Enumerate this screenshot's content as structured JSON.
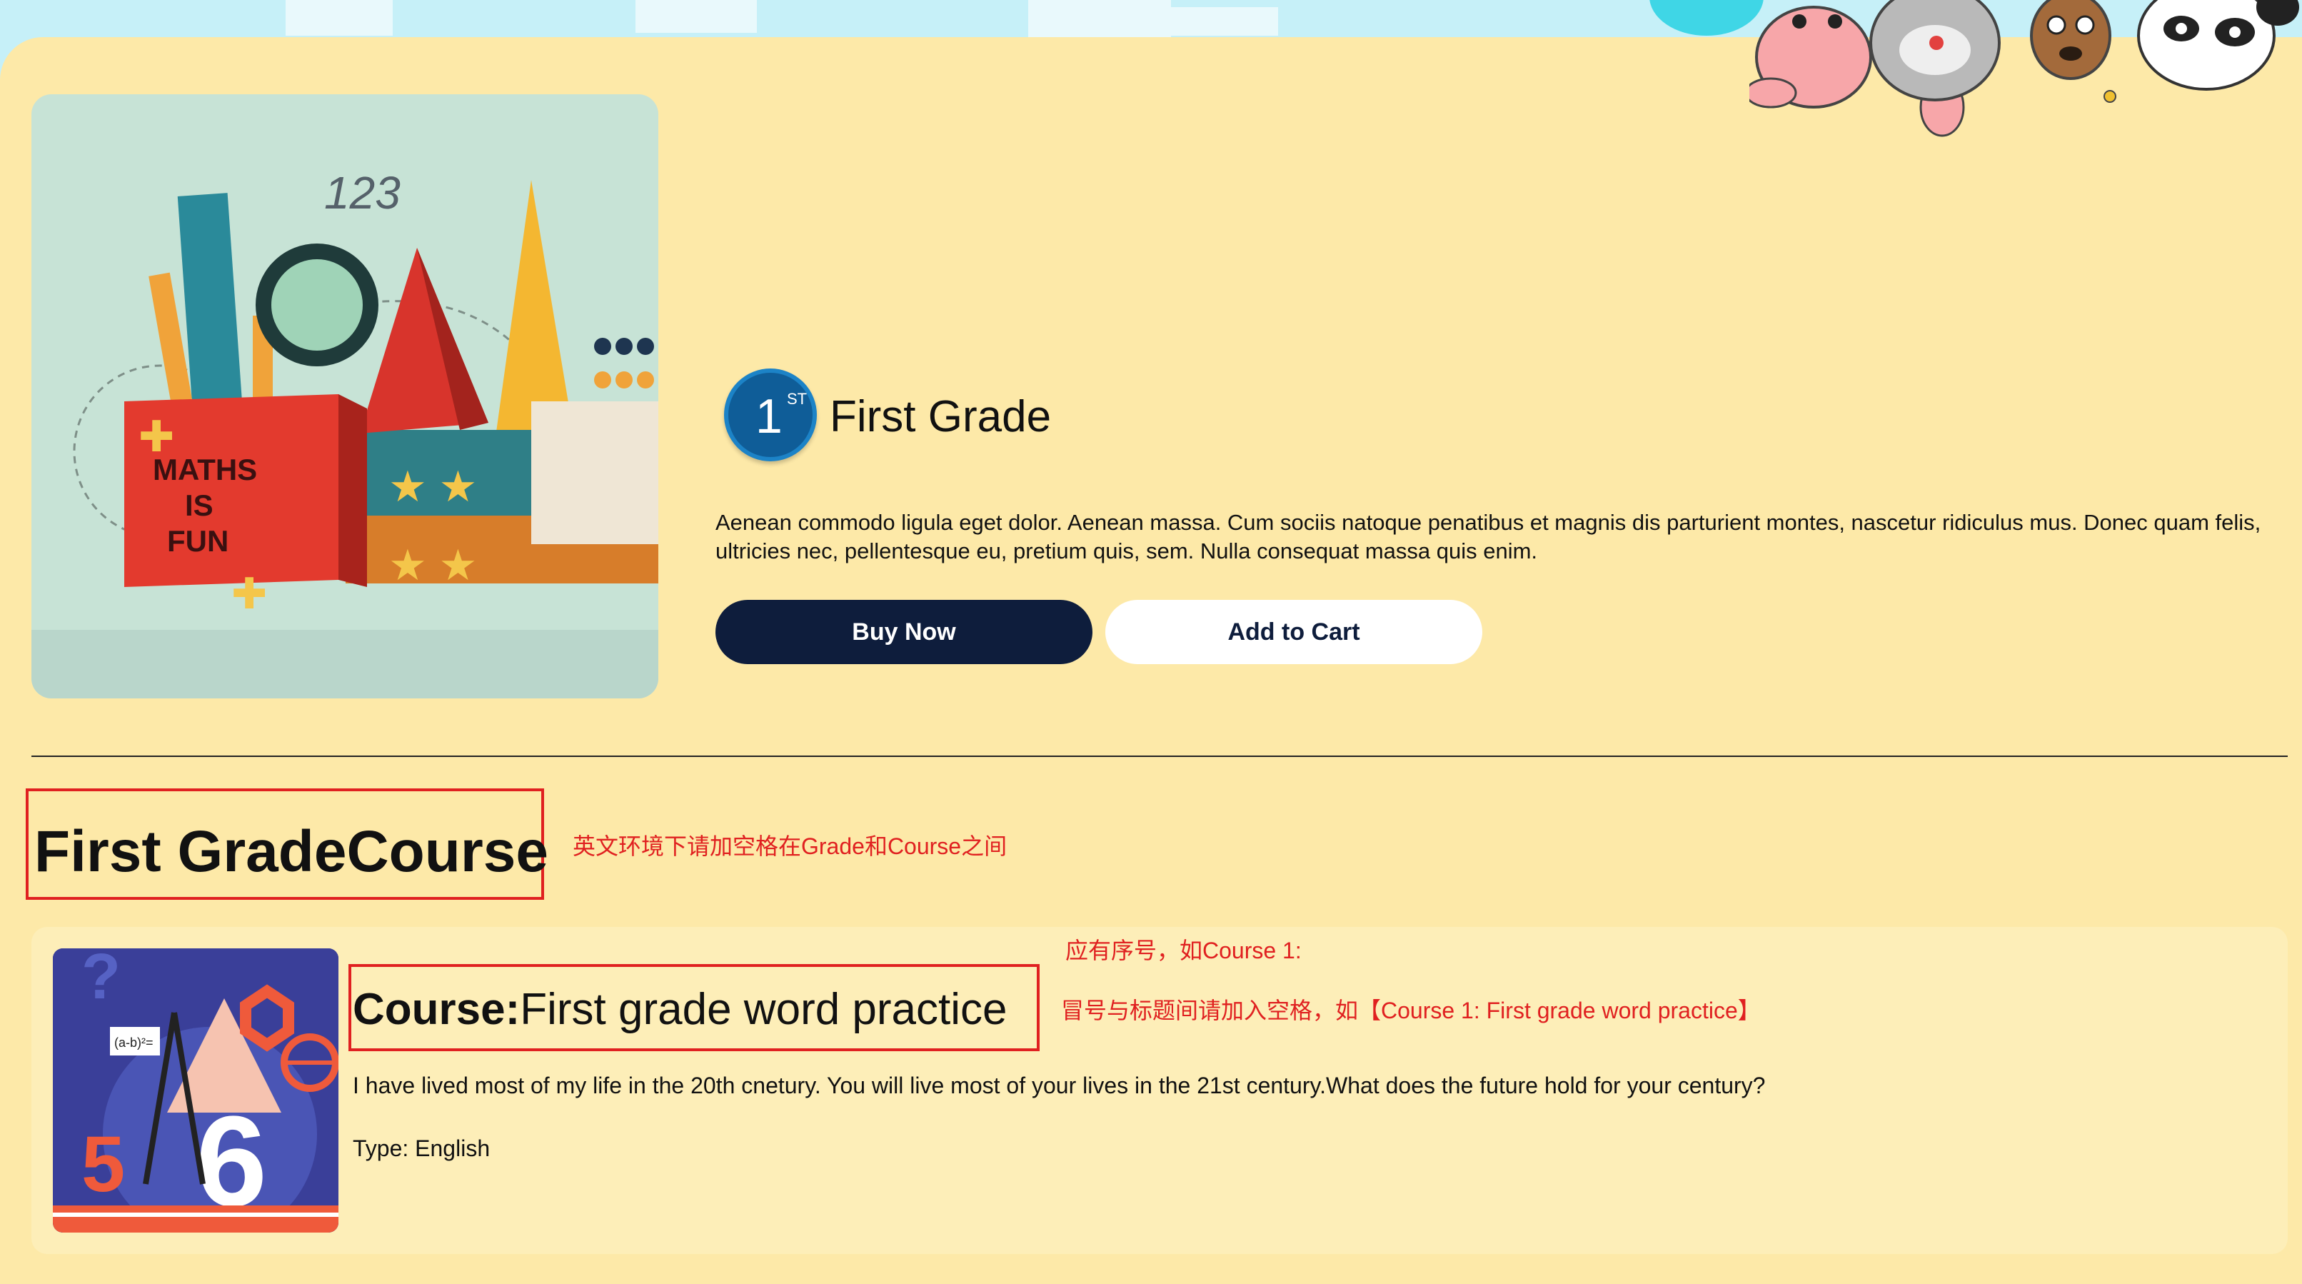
{
  "product": {
    "badge_number": "1",
    "badge_suffix": "ST",
    "title": "First Grade",
    "description": "Aenean commodo ligula eget dolor. Aenean massa. Cum sociis natoque penatibus et magnis dis parturient montes, nascetur ridiculus mus. Donec quam felis, ultricies nec, pellentesque eu, pretium quis, sem. Nulla consequat massa quis enim.",
    "buy_label": "Buy Now",
    "cart_label": "Add to Cart",
    "hero_image_text": {
      "numbers": "123",
      "box_line1": "MATHS",
      "box_line2": "IS",
      "box_line3": "FUN"
    }
  },
  "section": {
    "title": "First GradeCourse"
  },
  "annotations": {
    "section_note": "英文环境下请加空格在Grade和Course之间",
    "numbering_note": "应有序号，如Course 1:",
    "spacing_note": "冒号与标题间请加入空格，如【Course 1: First grade word practice】"
  },
  "course": {
    "prefix": "Course:",
    "name": "First grade word practice",
    "description": "I have lived most of my life in the 20th cnetury. You will live most of your lives in the 21st century.What does the future hold for your century?",
    "type_text": "Type: English",
    "image_text": "(a-b)²="
  },
  "colors": {
    "panel_bg": "#fde9a8",
    "card_bg": "#fdeeb8",
    "buy_button": "#0e1d3c",
    "annotation_red": "#e02020"
  }
}
